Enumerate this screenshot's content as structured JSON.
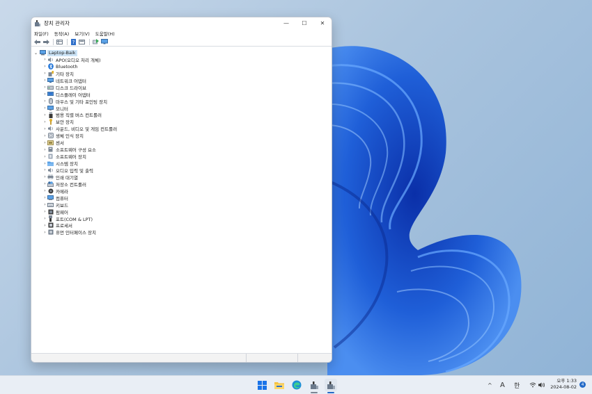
{
  "window": {
    "title": "장치 관리자",
    "controls": {
      "minimize": "—",
      "maximize": "☐",
      "close": "✕"
    }
  },
  "menu": [
    "파일(F)",
    "동작(A)",
    "보기(V)",
    "도움말(H)"
  ],
  "toolbar": [
    "back-icon",
    "forward-icon",
    "properties-grid-icon",
    "help-icon",
    "view-grid-icon",
    "update-driver-icon",
    "monitor-icon"
  ],
  "tree": {
    "root": {
      "chevron": "⌄",
      "label": "Laptop-Baik"
    },
    "items": [
      {
        "label": "APO(오디오 처리 개체)",
        "icon": "audio-icon"
      },
      {
        "label": "Bluetooth",
        "icon": "bluetooth-icon"
      },
      {
        "label": "기타 장치",
        "icon": "other-device-icon"
      },
      {
        "label": "네트워크 어댑터",
        "icon": "network-adapter-icon"
      },
      {
        "label": "디스크 드라이브",
        "icon": "disk-drive-icon"
      },
      {
        "label": "디스플레이 어댑터",
        "icon": "display-adapter-icon"
      },
      {
        "label": "마우스 및 기타 포인팅 장치",
        "icon": "mouse-icon"
      },
      {
        "label": "모니터",
        "icon": "monitor-icon"
      },
      {
        "label": "범용 직렬 버스 컨트롤러",
        "icon": "usb-icon"
      },
      {
        "label": "보안 장치",
        "icon": "security-device-icon"
      },
      {
        "label": "사운드, 비디오 및 게임 컨트롤러",
        "icon": "sound-icon"
      },
      {
        "label": "생체 인식 장치",
        "icon": "biometric-icon"
      },
      {
        "label": "센서",
        "icon": "sensor-icon"
      },
      {
        "label": "소프트웨어 구성 요소",
        "icon": "software-component-icon"
      },
      {
        "label": "소프트웨어 장치",
        "icon": "software-device-icon"
      },
      {
        "label": "시스템 장치",
        "icon": "system-device-icon"
      },
      {
        "label": "오디오 입력 및 출력",
        "icon": "audio-io-icon"
      },
      {
        "label": "인쇄 대기열",
        "icon": "print-queue-icon"
      },
      {
        "label": "저장소 컨트롤러",
        "icon": "storage-controller-icon"
      },
      {
        "label": "카메라",
        "icon": "camera-icon"
      },
      {
        "label": "컴퓨터",
        "icon": "computer-icon"
      },
      {
        "label": "키보드",
        "icon": "keyboard-icon"
      },
      {
        "label": "펌웨어",
        "icon": "firmware-icon"
      },
      {
        "label": "포트(COM & LPT)",
        "icon": "port-icon"
      },
      {
        "label": "프로세서",
        "icon": "processor-icon"
      },
      {
        "label": "휴먼 인터페이스 장치",
        "icon": "hid-icon"
      }
    ],
    "chevron": "›"
  },
  "taskbar": {
    "apps": [
      "start-icon",
      "file-explorer-icon",
      "edge-icon",
      "device-manager-icon",
      "device-manager-active-icon"
    ],
    "tray": {
      "chevron": "^",
      "font": "A",
      "ime": "한",
      "clock_time": "오후 1:33",
      "clock_date": "2024-08-02",
      "notification_count": "4"
    }
  },
  "colors": {
    "selection": "#cce4f7",
    "accent": "#2369c7",
    "wallpaper_blue": "#1f5fd8"
  }
}
